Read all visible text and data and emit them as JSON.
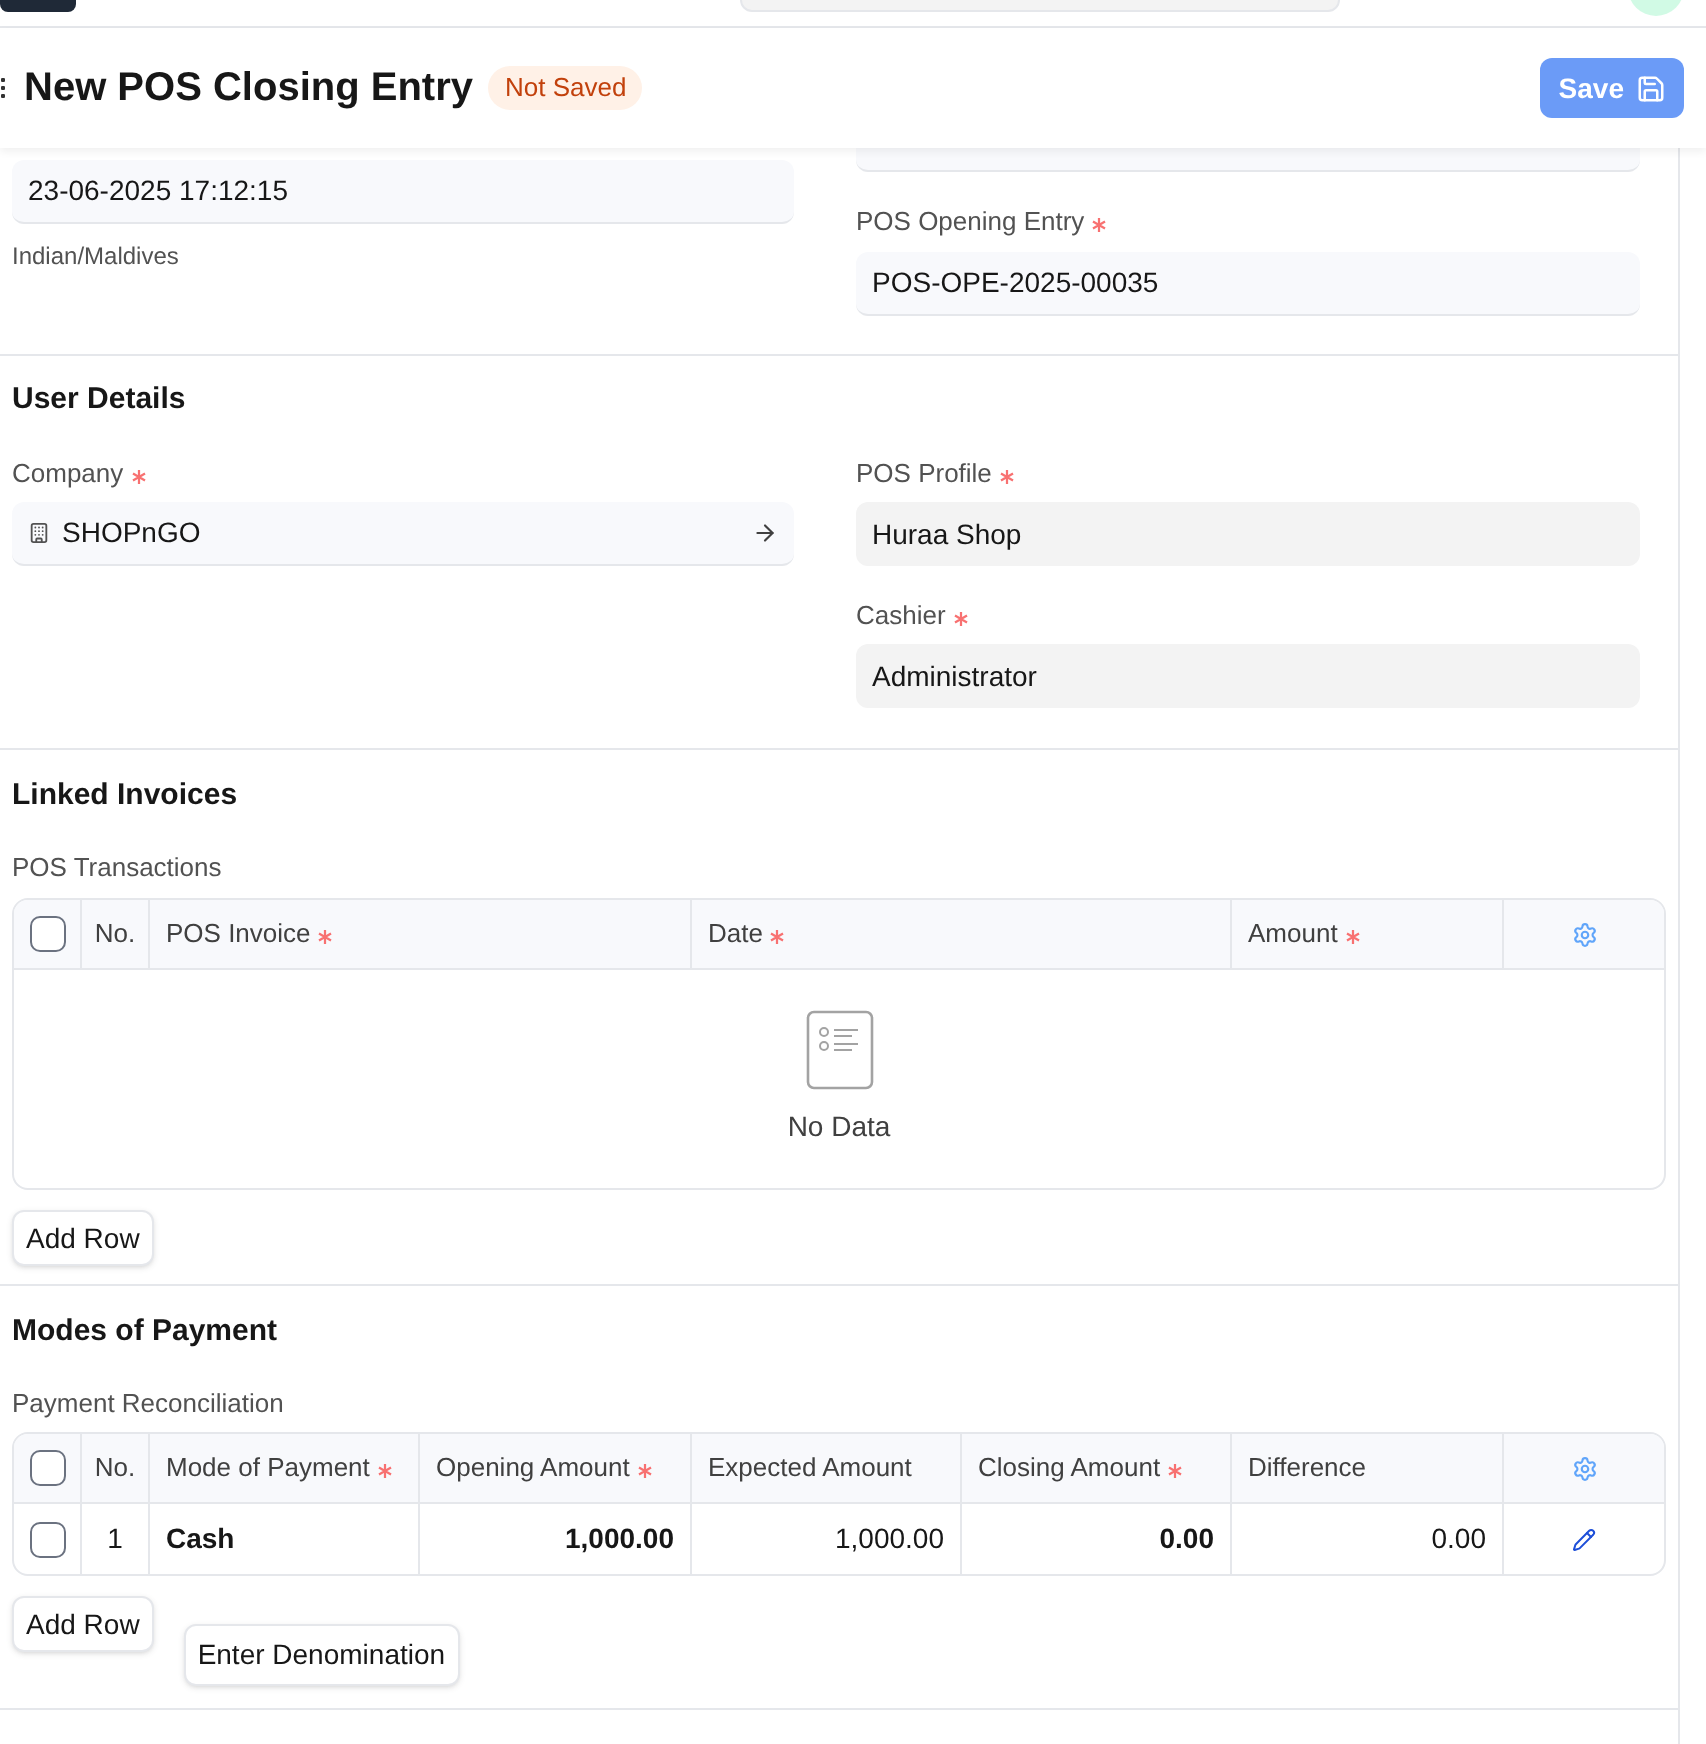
{
  "header": {
    "title": "New POS Closing Entry",
    "status": "Not Saved",
    "save_button": "Save"
  },
  "period": {
    "date_value": "23-06-2025 17:12:15",
    "timezone": "Indian/Maldives",
    "opening_entry": {
      "label": "POS Opening Entry",
      "required": true,
      "value": "POS-OPE-2025-00035"
    }
  },
  "user_details": {
    "heading": "User Details",
    "fields": [
      {
        "label": "Company",
        "required": true,
        "value": "SHOPnGO",
        "kind": "link"
      },
      {
        "label": "POS Profile",
        "required": true,
        "value": "Huraa Shop",
        "kind": "readonly"
      },
      {
        "label": "Cashier",
        "required": true,
        "value": "Administrator",
        "kind": "readonly"
      }
    ]
  },
  "linked_invoices": {
    "heading": "Linked Invoices",
    "table_label": "POS Transactions",
    "all_checked": false,
    "columns": [
      {
        "label": "No.",
        "required": false
      },
      {
        "label": "POS Invoice",
        "required": true
      },
      {
        "label": "Date",
        "required": true
      },
      {
        "label": "Amount",
        "required": true
      }
    ],
    "empty_text": "No Data",
    "add_row": "Add Row"
  },
  "modes_of_payment": {
    "heading": "Modes of Payment",
    "table_label": "Payment Reconciliation",
    "all_checked": false,
    "columns": [
      {
        "label": "No.",
        "required": false
      },
      {
        "label": "Mode of Payment",
        "required": true
      },
      {
        "label": "Opening Amount",
        "required": true
      },
      {
        "label": "Expected Amount",
        "required": false
      },
      {
        "label": "Closing Amount",
        "required": true
      },
      {
        "label": "Difference",
        "required": false
      }
    ],
    "rows": [
      {
        "checked": false,
        "cells": [
          "1",
          "Cash",
          "1,000.00",
          "1,000.00",
          "0.00",
          "0.00"
        ]
      }
    ],
    "add_row": "Add Row",
    "denomination_button": "Enter Denomination"
  }
}
